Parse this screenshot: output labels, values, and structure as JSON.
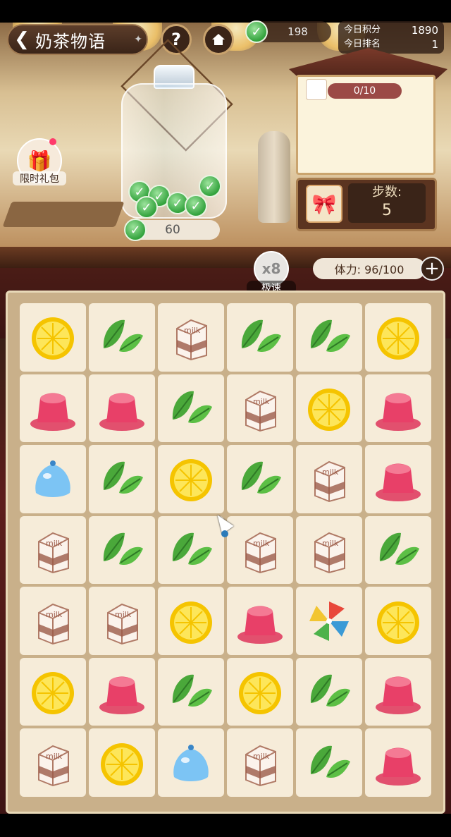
{
  "header": {
    "title": "奶茶物语",
    "help_label": "?",
    "coins": "198",
    "today_score_label": "今日积分",
    "today_score": "1890",
    "today_rank_label": "今日排名",
    "today_rank": "1"
  },
  "jar": {
    "count": "60"
  },
  "gift": {
    "label": "限时礼包"
  },
  "task": {
    "progress": "0/10"
  },
  "steps": {
    "label": "步数:",
    "value": "5"
  },
  "speed": {
    "multiplier": "x8",
    "label": "极速"
  },
  "stamina": {
    "text": "体力: 96/100",
    "plus": "+"
  },
  "board": {
    "rows": [
      [
        "lemon",
        "leaf",
        "milk",
        "leaf",
        "leaf",
        "lemon"
      ],
      [
        "jelly",
        "jelly",
        "leaf",
        "milk",
        "lemon",
        "jelly"
      ],
      [
        "water",
        "leaf",
        "lemon",
        "leaf",
        "milk",
        "jelly"
      ],
      [
        "milk",
        "leaf",
        "leaf",
        "milk",
        "milk",
        "leaf"
      ],
      [
        "milk",
        "milk",
        "lemon",
        "jelly",
        "pinwheel",
        "lemon"
      ],
      [
        "lemon",
        "jelly",
        "leaf",
        "lemon",
        "leaf",
        "jelly"
      ],
      [
        "milk",
        "lemon",
        "water",
        "milk",
        "leaf",
        "jelly"
      ]
    ],
    "milk_text": "milk"
  }
}
